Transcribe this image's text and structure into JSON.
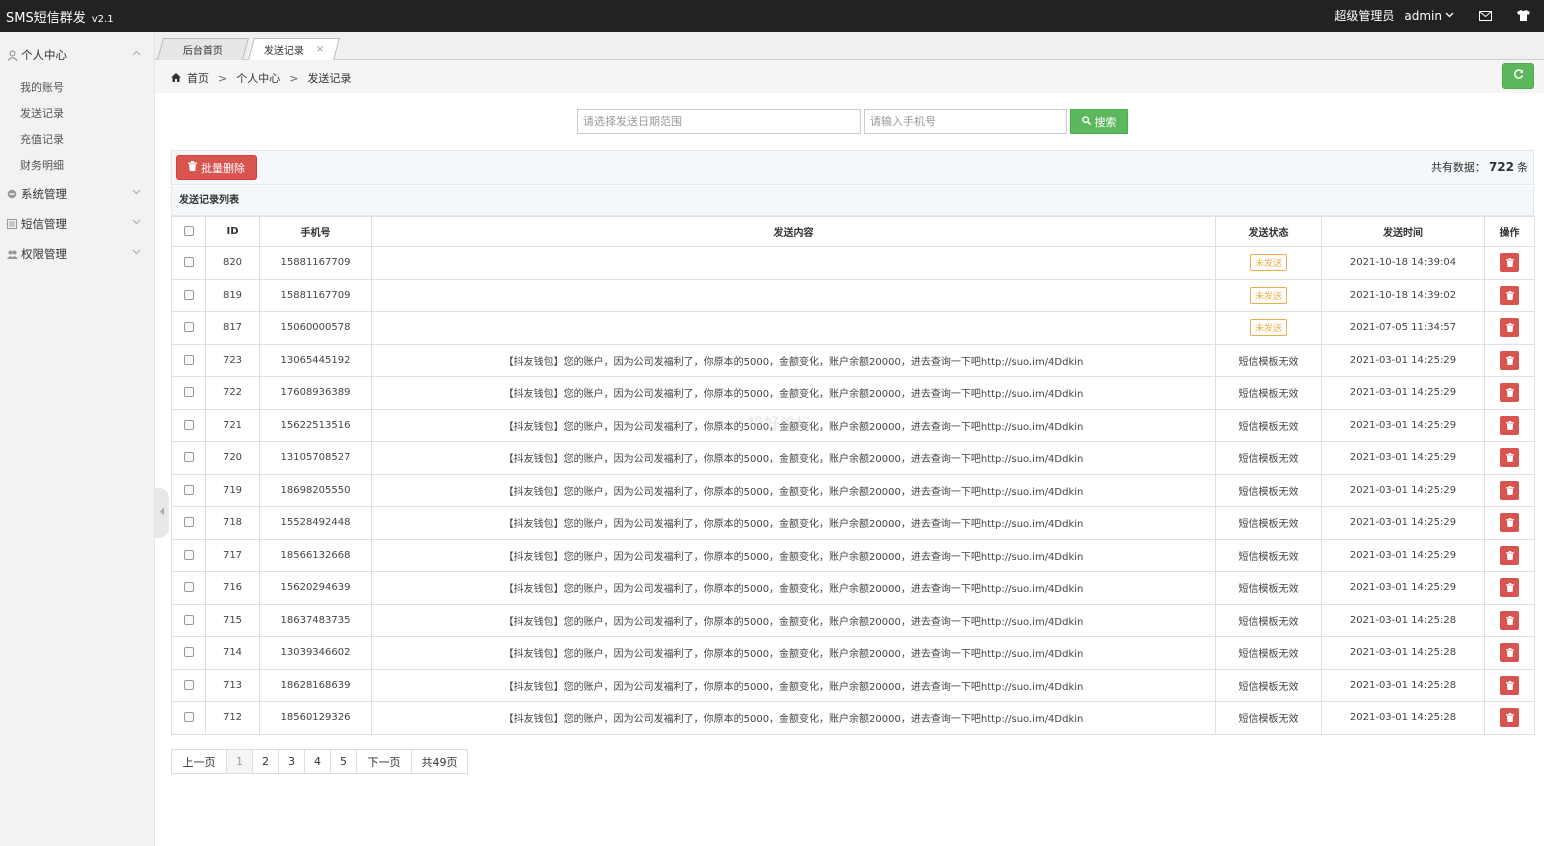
{
  "app": {
    "title": "SMS短信群发",
    "version": "v2.1"
  },
  "topbar": {
    "role": "超级管理员",
    "user": "admin",
    "mail_icon": "mail-icon",
    "shirt_icon": "shirt-icon"
  },
  "sidebar": {
    "groups": [
      {
        "label": "个人中心",
        "icon": "user-icon"
      },
      {
        "label": "系统管理",
        "icon": "settings-icon"
      },
      {
        "label": "短信管理",
        "icon": "list-icon"
      },
      {
        "label": "权限管理",
        "icon": "users-icon"
      }
    ],
    "items": [
      "我的账号",
      "发送记录",
      "充值记录",
      "财务明细"
    ]
  },
  "tabs": [
    {
      "label": "后台首页"
    },
    {
      "label": "发送记录"
    }
  ],
  "breadcrumb": {
    "home": "首页",
    "level1": "个人中心",
    "level2": "发送记录",
    "sep": ">"
  },
  "search": {
    "date_placeholder": "请选择发送日期范围",
    "phone_placeholder": "请输入手机号",
    "button": "搜索"
  },
  "toolbar": {
    "batch_delete": "批量删除",
    "total_prefix": "共有数据：",
    "total_count": "722",
    "total_suffix": "条"
  },
  "list_title": "发送记录列表",
  "table": {
    "headers": [
      "ID",
      "手机号",
      "发送内容",
      "发送状态",
      "发送时间",
      "操作"
    ],
    "rows": [
      {
        "id": "820",
        "phone": "15881167709",
        "content": "",
        "status": "未发送",
        "status_type": "unsent",
        "time": "2021-10-18 14:39:04"
      },
      {
        "id": "819",
        "phone": "15881167709",
        "content": "",
        "status": "未发送",
        "status_type": "unsent",
        "time": "2021-10-18 14:39:02"
      },
      {
        "id": "817",
        "phone": "15060000578",
        "content": "",
        "status": "未发送",
        "status_type": "unsent",
        "time": "2021-07-05 11:34:57"
      },
      {
        "id": "723",
        "phone": "13065445192",
        "content": "【抖友钱包】您的账户，因为公司发福利了，你原本的5000，金额变化，账户余额20000，进去查询一下吧http://suo.im/4Ddkin",
        "status": "短信模板无效",
        "status_type": "invalid",
        "time": "2021-03-01 14:25:29"
      },
      {
        "id": "722",
        "phone": "17608936389",
        "content": "【抖友钱包】您的账户，因为公司发福利了，你原本的5000，金额变化，账户余额20000，进去查询一下吧http://suo.im/4Ddkin",
        "status": "短信模板无效",
        "status_type": "invalid",
        "time": "2021-03-01 14:25:29"
      },
      {
        "id": "721",
        "phone": "15622513516",
        "content": "【抖友钱包】您的账户，因为公司发福利了，你原本的5000，金额变化，账户余额20000，进去查询一下吧http://suo.im/4Ddkin",
        "status": "短信模板无效",
        "status_type": "invalid",
        "time": "2021-03-01 14:25:29"
      },
      {
        "id": "720",
        "phone": "13105708527",
        "content": "【抖友钱包】您的账户，因为公司发福利了，你原本的5000，金额变化，账户余额20000，进去查询一下吧http://suo.im/4Ddkin",
        "status": "短信模板无效",
        "status_type": "invalid",
        "time": "2021-03-01 14:25:29"
      },
      {
        "id": "719",
        "phone": "18698205550",
        "content": "【抖友钱包】您的账户，因为公司发福利了，你原本的5000，金额变化，账户余额20000，进去查询一下吧http://suo.im/4Ddkin",
        "status": "短信模板无效",
        "status_type": "invalid",
        "time": "2021-03-01 14:25:29"
      },
      {
        "id": "718",
        "phone": "15528492448",
        "content": "【抖友钱包】您的账户，因为公司发福利了，你原本的5000，金额变化，账户余额20000，进去查询一下吧http://suo.im/4Ddkin",
        "status": "短信模板无效",
        "status_type": "invalid",
        "time": "2021-03-01 14:25:29"
      },
      {
        "id": "717",
        "phone": "18566132668",
        "content": "【抖友钱包】您的账户，因为公司发福利了，你原本的5000，金额变化，账户余额20000，进去查询一下吧http://suo.im/4Ddkin",
        "status": "短信模板无效",
        "status_type": "invalid",
        "time": "2021-03-01 14:25:29"
      },
      {
        "id": "716",
        "phone": "15620294639",
        "content": "【抖友钱包】您的账户，因为公司发福利了，你原本的5000，金额变化，账户余额20000，进去查询一下吧http://suo.im/4Ddkin",
        "status": "短信模板无效",
        "status_type": "invalid",
        "time": "2021-03-01 14:25:29"
      },
      {
        "id": "715",
        "phone": "18637483735",
        "content": "【抖友钱包】您的账户，因为公司发福利了，你原本的5000，金额变化，账户余额20000，进去查询一下吧http://suo.im/4Ddkin",
        "status": "短信模板无效",
        "status_type": "invalid",
        "time": "2021-03-01 14:25:28"
      },
      {
        "id": "714",
        "phone": "13039346602",
        "content": "【抖友钱包】您的账户，因为公司发福利了，你原本的5000，金额变化，账户余额20000，进去查询一下吧http://suo.im/4Ddkin",
        "status": "短信模板无效",
        "status_type": "invalid",
        "time": "2021-03-01 14:25:28"
      },
      {
        "id": "713",
        "phone": "18628168639",
        "content": "【抖友钱包】您的账户，因为公司发福利了，你原本的5000，金额变化，账户余额20000，进去查询一下吧http://suo.im/4Ddkin",
        "status": "短信模板无效",
        "status_type": "invalid",
        "time": "2021-03-01 14:25:28"
      },
      {
        "id": "712",
        "phone": "18560129326",
        "content": "【抖友钱包】您的账户，因为公司发福利了，你原本的5000，金额变化，账户余额20000，进去查询一下吧http://suo.im/4Ddkin",
        "status": "短信模板无效",
        "status_type": "invalid",
        "time": "2021-03-01 14:25:28"
      }
    ]
  },
  "pagination": {
    "prev": "上一页",
    "pages": [
      "1",
      "2",
      "3",
      "4",
      "5"
    ],
    "current": "1",
    "next": "下一页",
    "total": "共49页"
  },
  "watermark": "极好论坛",
  "colors": {
    "topbar": "#222222",
    "success": "#5cb85c",
    "danger": "#d9534f",
    "warning": "#f0ad4e"
  }
}
